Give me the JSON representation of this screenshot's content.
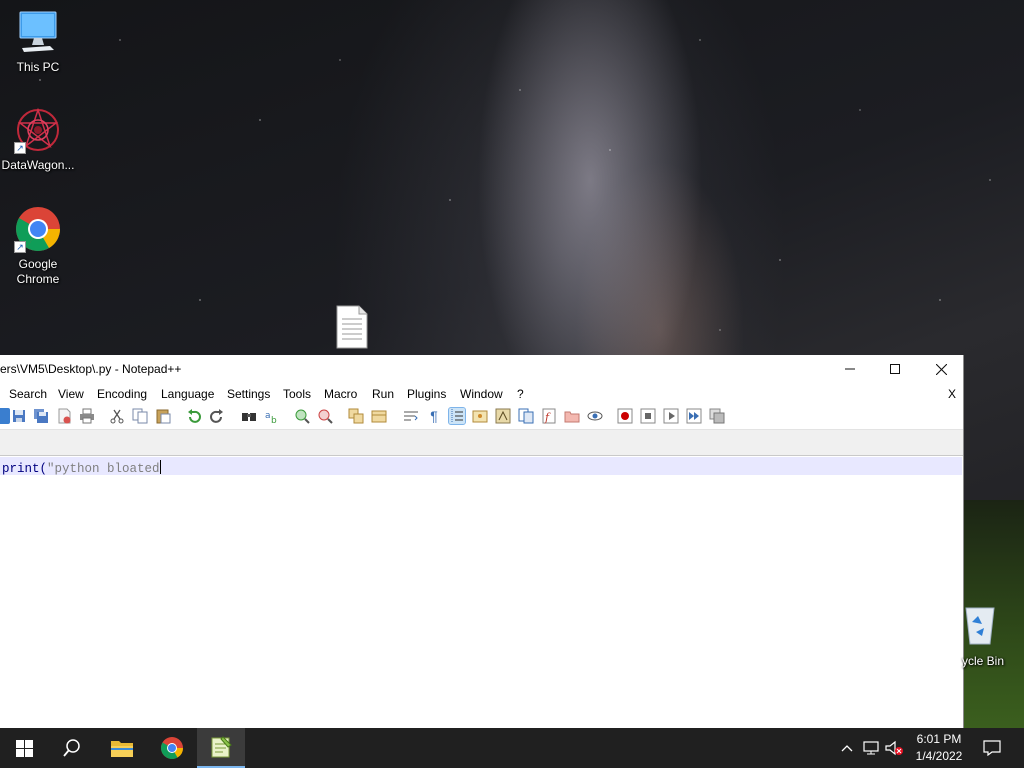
{
  "desktop": {
    "icons": [
      {
        "label": "This PC"
      },
      {
        "label": "DataWagon..."
      },
      {
        "label": "Google Chrome"
      },
      {
        "label": ""
      }
    ],
    "recycle_bin_label": "ycle Bin"
  },
  "window": {
    "title": "ers\\VM5\\Desktop\\.py - Notepad++",
    "minimize_icon": "minimize-icon",
    "maximize_icon": "maximize-icon",
    "close_icon": "close-icon",
    "menu": [
      "Search",
      "View",
      "Encoding",
      "Language",
      "Settings",
      "Tools",
      "Macro",
      "Run",
      "Plugins",
      "Window",
      "?"
    ],
    "menu_close": "X",
    "toolbar_icons": [
      "new-file-icon",
      "open-file-icon",
      "save-icon",
      "save-all-icon",
      "close-icon",
      "close-all-icon",
      "print-icon",
      "cut-icon",
      "copy-icon",
      "paste-icon",
      "undo-icon",
      "redo-icon",
      "find-icon",
      "replace-icon",
      "zoom-in-icon",
      "zoom-out-icon",
      "sync-vertical-icon",
      "sync-horizontal-icon",
      "word-wrap-icon",
      "show-all-characters-icon",
      "indent-guide-icon",
      "user-defined-language-icon",
      "document-map-icon",
      "document-list-icon",
      "function-list-icon",
      "folder-as-workspace-icon",
      "monitoring-icon",
      "record-macro-icon",
      "stop-recording-icon",
      "playback-icon",
      "run-macro-multiple-icon",
      "save-macro-icon"
    ],
    "editor": {
      "line_1_keyword": "print(",
      "line_1_string": "\"python bloated"
    }
  },
  "taskbar": {
    "icons": [
      "windows-start-icon",
      "search-icon",
      "file-explorer-icon",
      "chrome-icon",
      "notepad-plus-plus-icon"
    ],
    "tray_icons": [
      "chevron-up-icon",
      "network-icon",
      "volume-muted-icon",
      "action-center-icon"
    ],
    "time": "6:01 PM",
    "date": "1/4/2022"
  },
  "colors": {
    "taskbar": "#202020",
    "current_line": "#e8e8ff",
    "keyword": "#000080",
    "string": "#808080"
  }
}
